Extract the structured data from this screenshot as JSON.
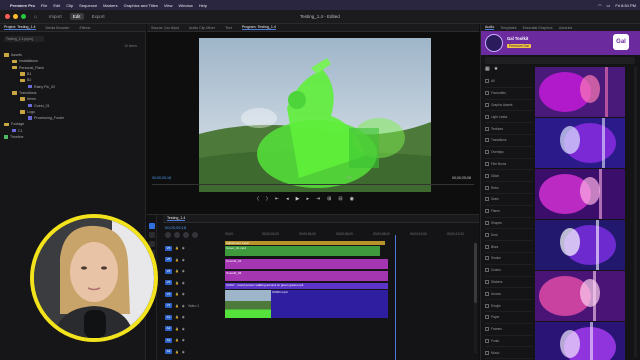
{
  "menubar": {
    "app": "Premiere Pro",
    "items": [
      "File",
      "Edit",
      "Clip",
      "Sequence",
      "Markers",
      "Graphics and Titles",
      "View",
      "Window",
      "Help"
    ],
    "time": "Fri 8:54 PM"
  },
  "window": {
    "title": "Testing_1.4 - Edited",
    "workspace_tabs": [
      "Import",
      "Edit",
      "Export"
    ],
    "active_workspace": "Edit"
  },
  "project_panel": {
    "tabs": [
      "Project: Testing_1.4",
      "Media Browser",
      "Effects",
      "Effect Controls",
      "Audio Track Mixer"
    ],
    "search_placeholder": "Testing_1.4.prproj",
    "item_count": "10 items",
    "tree": [
      {
        "label": "Assets",
        "indent": 0,
        "type": "folder"
      },
      {
        "label": "Installations",
        "indent": 1,
        "type": "folder"
      },
      {
        "label": "Personal_Flash",
        "indent": 1,
        "type": "folder"
      },
      {
        "label": "B1",
        "indent": 2,
        "type": "folder"
      },
      {
        "label": "B2",
        "indent": 2,
        "type": "folder"
      },
      {
        "label": "Rainy Pic_02",
        "indent": 3,
        "type": "item"
      },
      {
        "label": "Transitions",
        "indent": 1,
        "type": "folder"
      },
      {
        "label": "Items",
        "indent": 2,
        "type": "folder"
      },
      {
        "label": "Guest_01",
        "indent": 3,
        "type": "item"
      },
      {
        "label": "Logo",
        "indent": 2,
        "type": "folder"
      },
      {
        "label": "Processing_Footer",
        "indent": 3,
        "type": "item"
      },
      {
        "label": "Footage",
        "indent": 0,
        "type": "folder"
      },
      {
        "label": "C1",
        "indent": 1,
        "type": "item"
      },
      {
        "label": "Timeline",
        "indent": 0,
        "type": "sequence"
      }
    ]
  },
  "program_monitor": {
    "tabs": [
      "Source: (no clips)",
      "Audio Clip Mixer",
      "Text",
      "Program: Testing_1.4"
    ],
    "timecode_left": "00;00;05;18",
    "timecode_right": "00;00;25;08",
    "fit": "Fit",
    "resolution": "Full"
  },
  "timeline": {
    "tab": "Testing_1.4",
    "timecode": "00;00;05;18",
    "ruler": [
      "00;00",
      "00;00;02;00",
      "00;00;04;00",
      "00;00;06;00",
      "00;00;08;00",
      "00;00;10;00",
      "00;00;12;00"
    ],
    "tracks": [
      {
        "id": "V6",
        "name": ""
      },
      {
        "id": "V5",
        "name": ""
      },
      {
        "id": "V4",
        "name": ""
      },
      {
        "id": "V3",
        "name": ""
      },
      {
        "id": "V2",
        "name": ""
      },
      {
        "id": "V1",
        "name": "Video 1"
      },
      {
        "id": "A1",
        "name": ""
      },
      {
        "id": "A2",
        "name": ""
      },
      {
        "id": "A3",
        "name": ""
      },
      {
        "id": "A4",
        "name": ""
      }
    ],
    "clips": [
      {
        "label": "Adjustment Layer",
        "color": "#b8932c"
      },
      {
        "label": "Green_01.mp4",
        "color": "#3f9a3d"
      },
      {
        "label": "Smooth_01",
        "color": "#a437b1"
      },
      {
        "label": "Smooth_02",
        "color": "#a437b1"
      },
      {
        "label": "C0017 - Good person walking around on green grass.mp4",
        "color": "#5c35c8"
      },
      {
        "label": "C0021.mp4",
        "color": "#2f1fa0"
      }
    ]
  },
  "side_panel": {
    "tabs": [
      "Audio",
      "Templates",
      "Essential Graphics",
      "Libraries"
    ],
    "app_name": "Gal Toolkit",
    "badge": "Premium Gal",
    "box_label": "Gal",
    "categories": [
      "All",
      "Favourites",
      "Graphic Assets",
      "Light Leaks",
      "Textures",
      "Transitions",
      "Overlays",
      "Film Burns",
      "Glitch",
      "Retro",
      "Grain",
      "Flares",
      "Shapes",
      "Dust",
      "Blurs",
      "Smoke",
      "Zooms",
      "Stickers",
      "Arrows",
      "Emojis",
      "Paper",
      "Frames",
      "Fonts",
      "Music",
      "SFX"
    ],
    "accent": "#6b2a9e"
  },
  "colors": {
    "accent_blue": "#2f6fe0",
    "webcam_ring": "#f2e31c"
  }
}
